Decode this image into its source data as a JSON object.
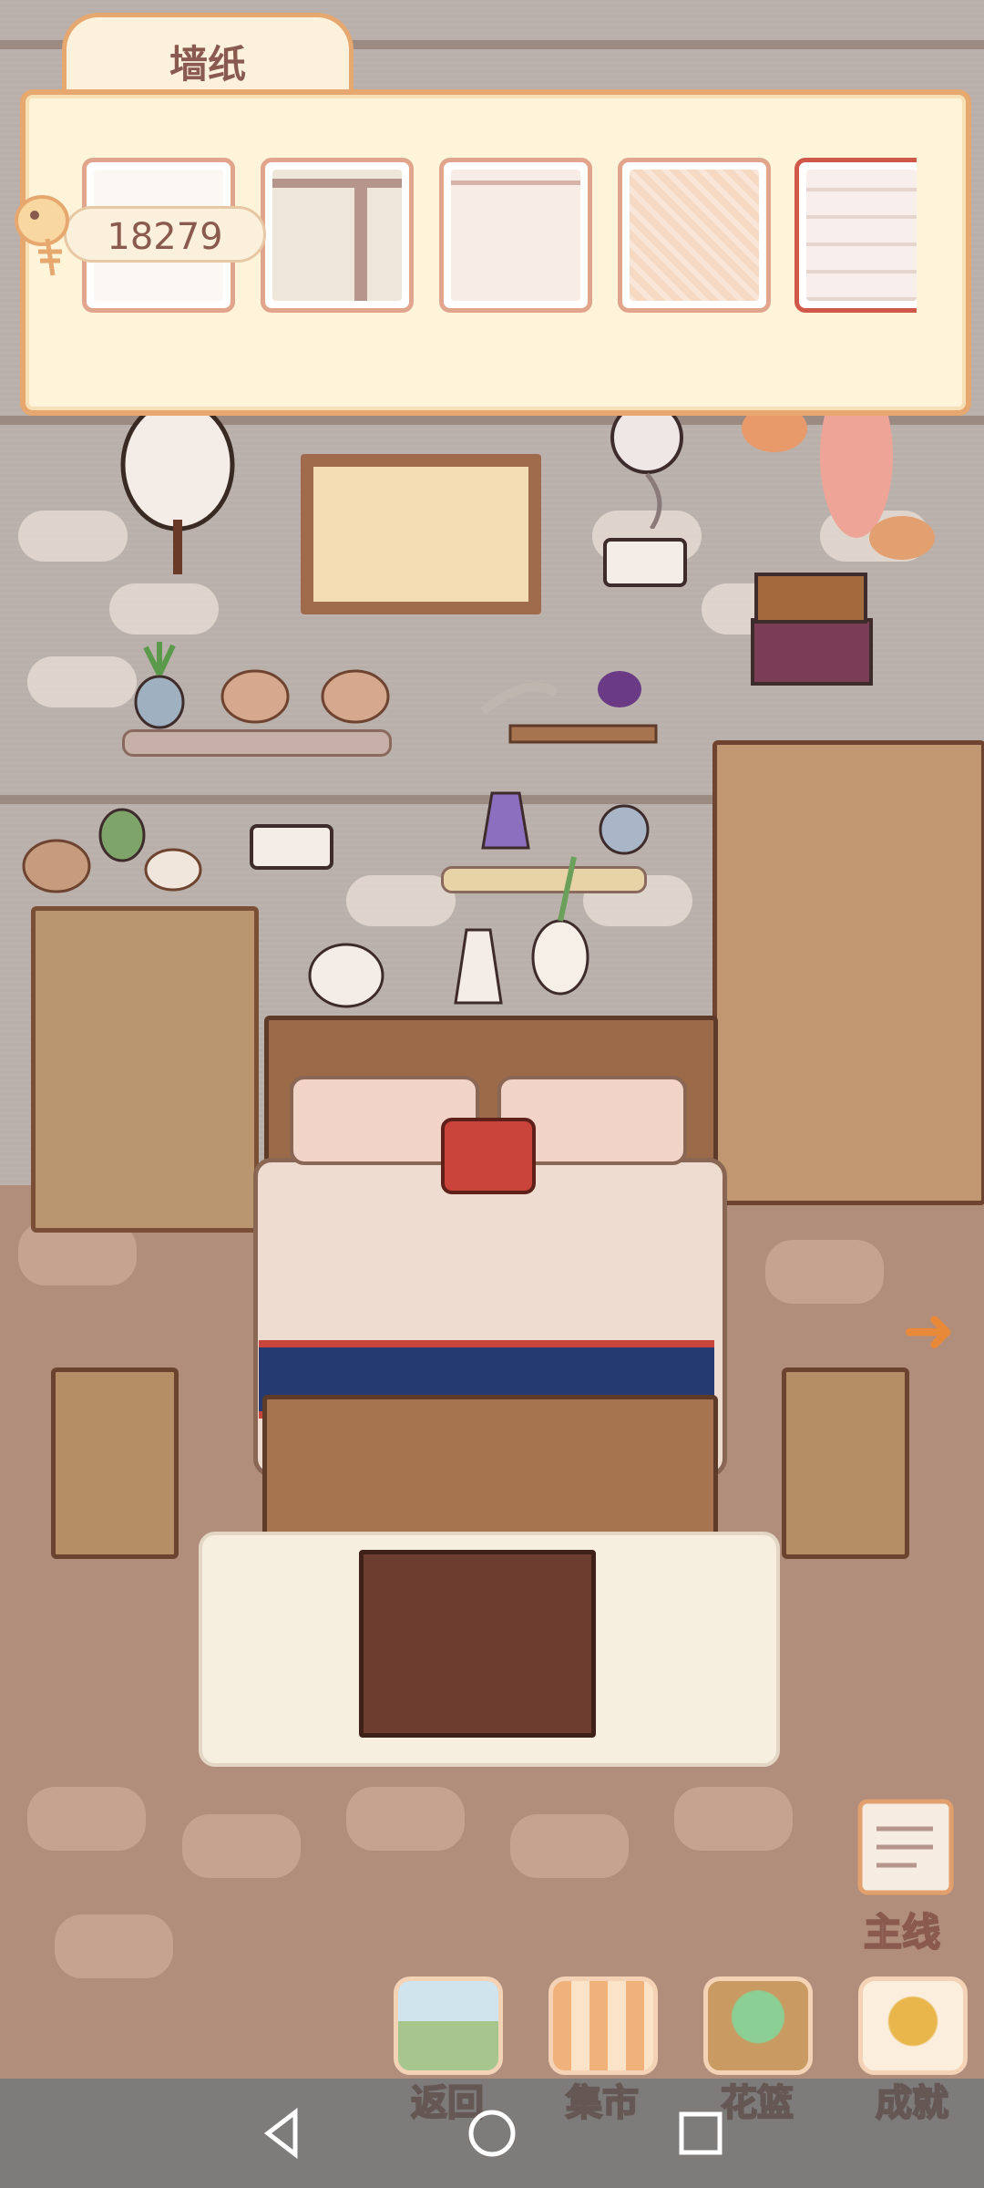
{
  "panel": {
    "tab_label": "墙纸",
    "currency_value": "18279",
    "currency_icon": "fishbone-icon",
    "swatches": [
      {
        "name": "plain-white",
        "color": "#fbf7f2"
      },
      {
        "name": "t-stripe",
        "color": "#efe6da"
      },
      {
        "name": "pink-plain",
        "color": "#f8ede6"
      },
      {
        "name": "herringbone-peach",
        "color": "#f6d9c3"
      },
      {
        "name": "brick-white",
        "color": "#f8efec"
      }
    ]
  },
  "bottom_nav": {
    "back_label": "返回",
    "market_label": "集市",
    "basket_label": "花篮",
    "achievement_label": "成就",
    "quest_label": "主线"
  },
  "colors": {
    "accent": "#e7a86f",
    "panel_bg": "#fdf4da",
    "wall": "#b9b0ab",
    "floor": "#b18e7c",
    "arrow": "#e8893a"
  }
}
